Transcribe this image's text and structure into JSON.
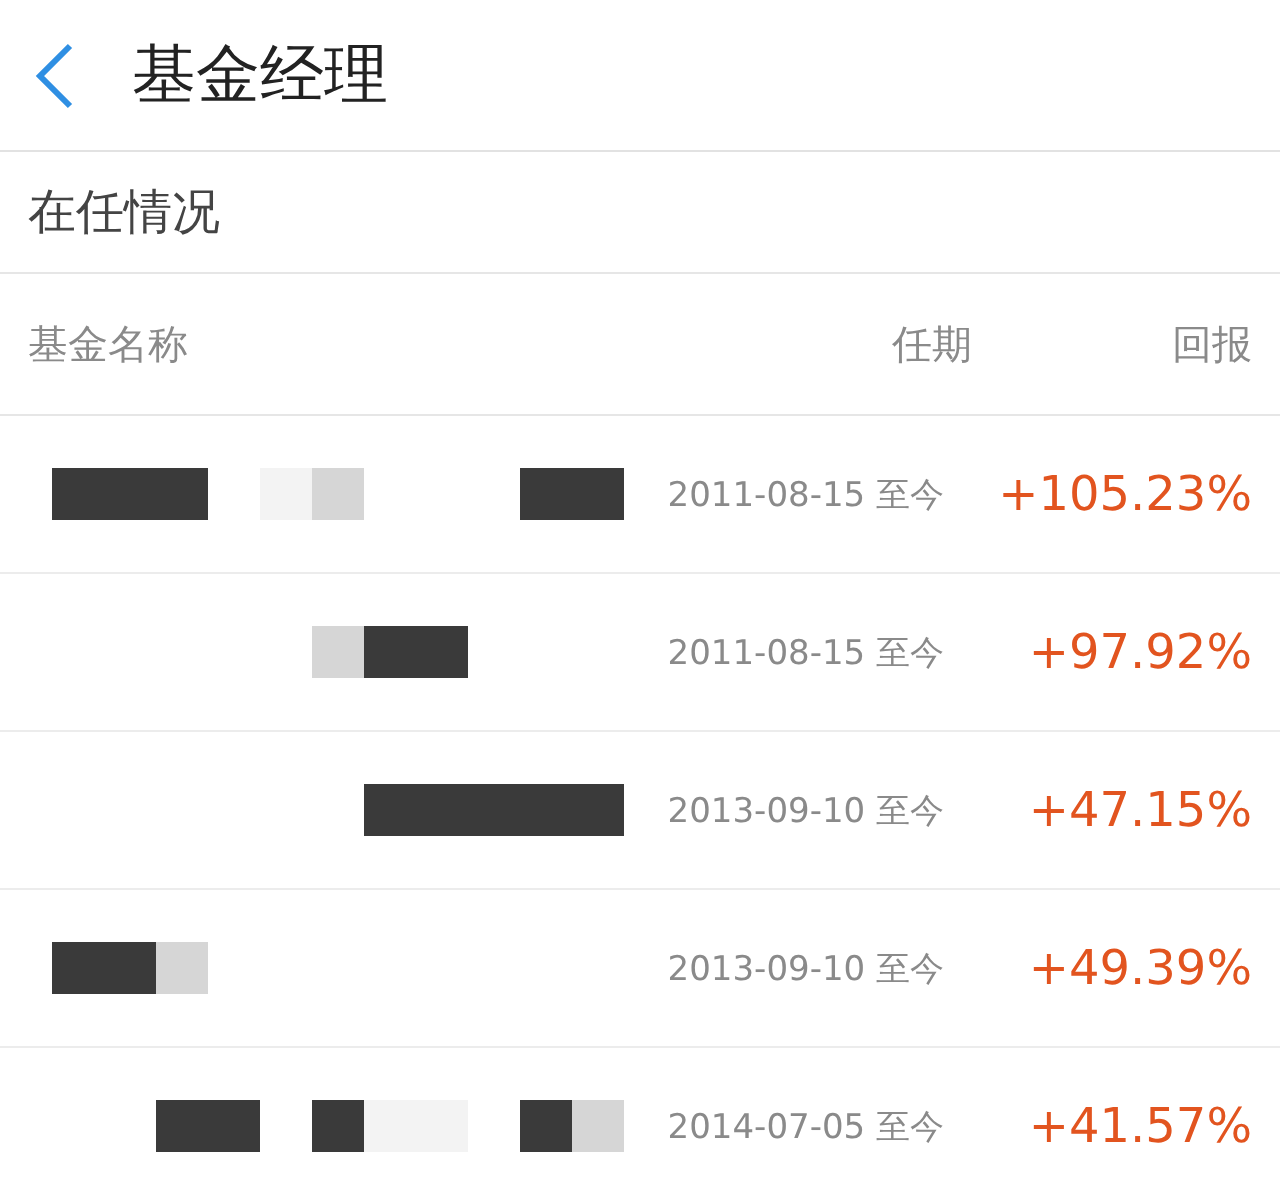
{
  "header": {
    "title": "基金经理"
  },
  "section": {
    "title": "在任情况"
  },
  "table": {
    "columns": [
      "基金名称",
      "任期",
      "回报"
    ],
    "rows": [
      {
        "tenure": "2011-08-15 至今",
        "return": "+105.23%"
      },
      {
        "tenure": "2011-08-15 至今",
        "return": "+97.92%"
      },
      {
        "tenure": "2013-09-10 至今",
        "return": "+47.15%"
      },
      {
        "tenure": "2013-09-10 至今",
        "return": "+49.39%"
      },
      {
        "tenure": "2014-07-05 至今",
        "return": "+41.57%"
      }
    ]
  }
}
